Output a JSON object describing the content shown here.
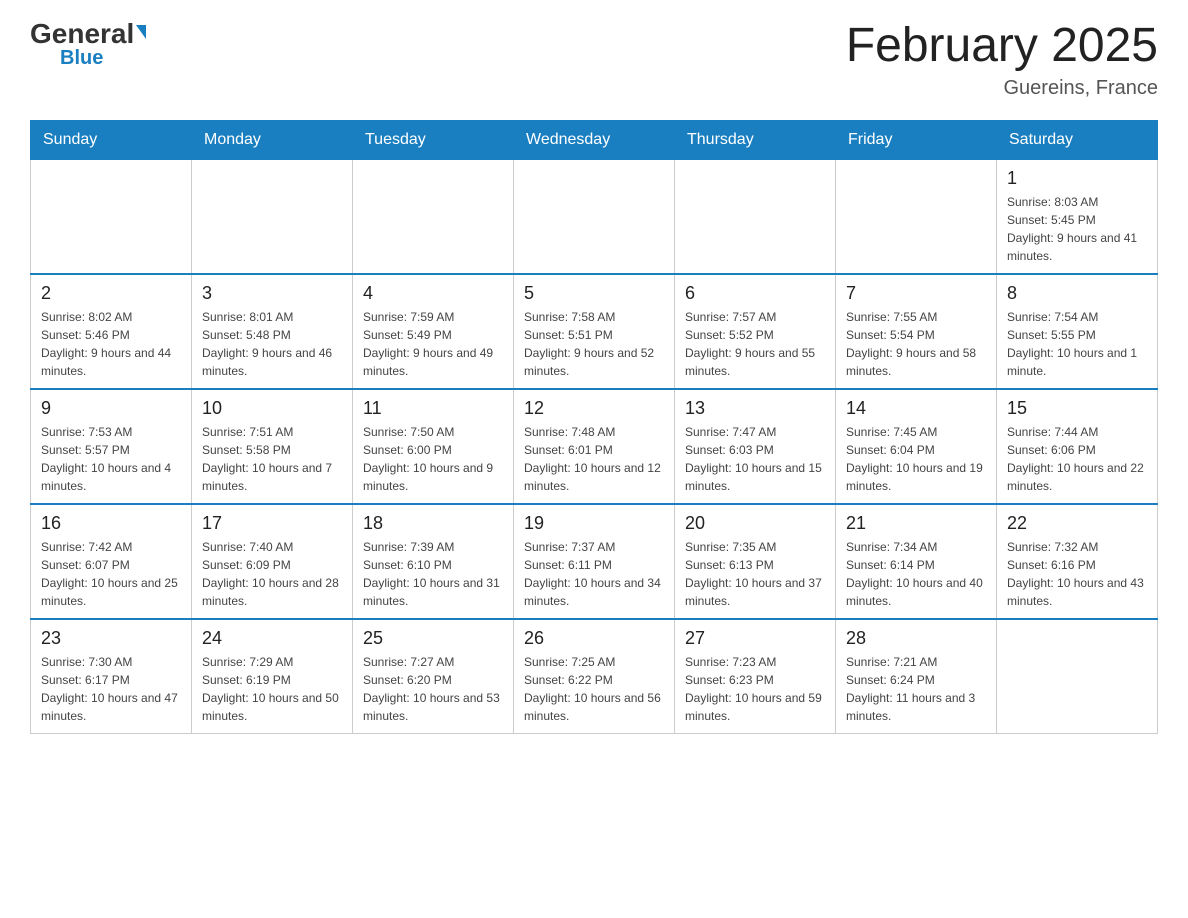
{
  "header": {
    "logo_general": "General",
    "logo_blue": "Blue",
    "month_title": "February 2025",
    "location": "Guereins, France"
  },
  "days_of_week": [
    "Sunday",
    "Monday",
    "Tuesday",
    "Wednesday",
    "Thursday",
    "Friday",
    "Saturday"
  ],
  "weeks": [
    [
      {
        "day": "",
        "info": ""
      },
      {
        "day": "",
        "info": ""
      },
      {
        "day": "",
        "info": ""
      },
      {
        "day": "",
        "info": ""
      },
      {
        "day": "",
        "info": ""
      },
      {
        "day": "",
        "info": ""
      },
      {
        "day": "1",
        "info": "Sunrise: 8:03 AM\nSunset: 5:45 PM\nDaylight: 9 hours and 41 minutes."
      }
    ],
    [
      {
        "day": "2",
        "info": "Sunrise: 8:02 AM\nSunset: 5:46 PM\nDaylight: 9 hours and 44 minutes."
      },
      {
        "day": "3",
        "info": "Sunrise: 8:01 AM\nSunset: 5:48 PM\nDaylight: 9 hours and 46 minutes."
      },
      {
        "day": "4",
        "info": "Sunrise: 7:59 AM\nSunset: 5:49 PM\nDaylight: 9 hours and 49 minutes."
      },
      {
        "day": "5",
        "info": "Sunrise: 7:58 AM\nSunset: 5:51 PM\nDaylight: 9 hours and 52 minutes."
      },
      {
        "day": "6",
        "info": "Sunrise: 7:57 AM\nSunset: 5:52 PM\nDaylight: 9 hours and 55 minutes."
      },
      {
        "day": "7",
        "info": "Sunrise: 7:55 AM\nSunset: 5:54 PM\nDaylight: 9 hours and 58 minutes."
      },
      {
        "day": "8",
        "info": "Sunrise: 7:54 AM\nSunset: 5:55 PM\nDaylight: 10 hours and 1 minute."
      }
    ],
    [
      {
        "day": "9",
        "info": "Sunrise: 7:53 AM\nSunset: 5:57 PM\nDaylight: 10 hours and 4 minutes."
      },
      {
        "day": "10",
        "info": "Sunrise: 7:51 AM\nSunset: 5:58 PM\nDaylight: 10 hours and 7 minutes."
      },
      {
        "day": "11",
        "info": "Sunrise: 7:50 AM\nSunset: 6:00 PM\nDaylight: 10 hours and 9 minutes."
      },
      {
        "day": "12",
        "info": "Sunrise: 7:48 AM\nSunset: 6:01 PM\nDaylight: 10 hours and 12 minutes."
      },
      {
        "day": "13",
        "info": "Sunrise: 7:47 AM\nSunset: 6:03 PM\nDaylight: 10 hours and 15 minutes."
      },
      {
        "day": "14",
        "info": "Sunrise: 7:45 AM\nSunset: 6:04 PM\nDaylight: 10 hours and 19 minutes."
      },
      {
        "day": "15",
        "info": "Sunrise: 7:44 AM\nSunset: 6:06 PM\nDaylight: 10 hours and 22 minutes."
      }
    ],
    [
      {
        "day": "16",
        "info": "Sunrise: 7:42 AM\nSunset: 6:07 PM\nDaylight: 10 hours and 25 minutes."
      },
      {
        "day": "17",
        "info": "Sunrise: 7:40 AM\nSunset: 6:09 PM\nDaylight: 10 hours and 28 minutes."
      },
      {
        "day": "18",
        "info": "Sunrise: 7:39 AM\nSunset: 6:10 PM\nDaylight: 10 hours and 31 minutes."
      },
      {
        "day": "19",
        "info": "Sunrise: 7:37 AM\nSunset: 6:11 PM\nDaylight: 10 hours and 34 minutes."
      },
      {
        "day": "20",
        "info": "Sunrise: 7:35 AM\nSunset: 6:13 PM\nDaylight: 10 hours and 37 minutes."
      },
      {
        "day": "21",
        "info": "Sunrise: 7:34 AM\nSunset: 6:14 PM\nDaylight: 10 hours and 40 minutes."
      },
      {
        "day": "22",
        "info": "Sunrise: 7:32 AM\nSunset: 6:16 PM\nDaylight: 10 hours and 43 minutes."
      }
    ],
    [
      {
        "day": "23",
        "info": "Sunrise: 7:30 AM\nSunset: 6:17 PM\nDaylight: 10 hours and 47 minutes."
      },
      {
        "day": "24",
        "info": "Sunrise: 7:29 AM\nSunset: 6:19 PM\nDaylight: 10 hours and 50 minutes."
      },
      {
        "day": "25",
        "info": "Sunrise: 7:27 AM\nSunset: 6:20 PM\nDaylight: 10 hours and 53 minutes."
      },
      {
        "day": "26",
        "info": "Sunrise: 7:25 AM\nSunset: 6:22 PM\nDaylight: 10 hours and 56 minutes."
      },
      {
        "day": "27",
        "info": "Sunrise: 7:23 AM\nSunset: 6:23 PM\nDaylight: 10 hours and 59 minutes."
      },
      {
        "day": "28",
        "info": "Sunrise: 7:21 AM\nSunset: 6:24 PM\nDaylight: 11 hours and 3 minutes."
      },
      {
        "day": "",
        "info": ""
      }
    ]
  ]
}
